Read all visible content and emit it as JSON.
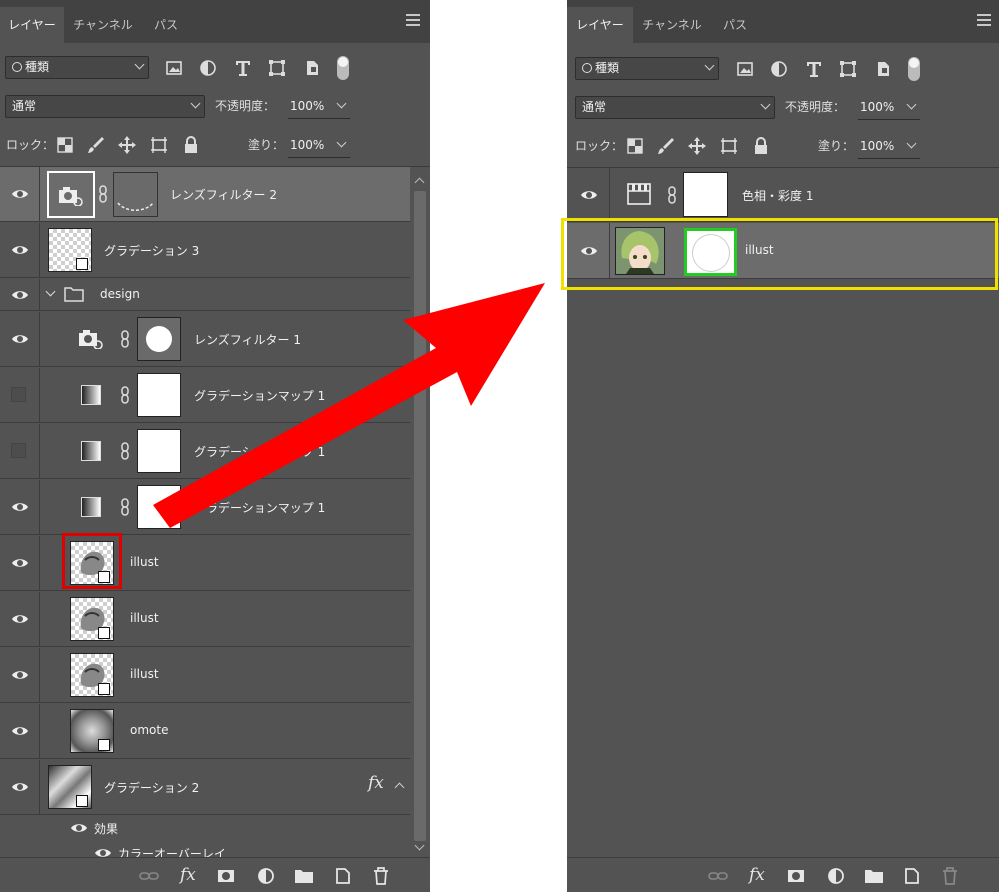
{
  "left_panel": {
    "tabs": [
      "レイヤー",
      "チャンネル",
      "パス"
    ],
    "filter_kind": "種類",
    "blend_mode": "通常",
    "opacity_label": "不透明度：",
    "opacity_value": "100%",
    "lock_label": "ロック：",
    "fill_label": "塗り：",
    "fill_value": "100%",
    "layers": [
      {
        "name": "レンズフィルター 2",
        "visible": true
      },
      {
        "name": "グラデーション 3",
        "visible": true
      },
      {
        "name": "design",
        "visible": true,
        "type": "group"
      },
      {
        "name": "レンズフィルター 1",
        "visible": true
      },
      {
        "name": "グラデーションマップ 1",
        "visible": false
      },
      {
        "name": "グラデーションマップ 1",
        "visible": false
      },
      {
        "name": "グラデーションマップ 1",
        "visible": true
      },
      {
        "name": "illust",
        "visible": true,
        "highlight": "#e00000"
      },
      {
        "name": "illust",
        "visible": true
      },
      {
        "name": "illust",
        "visible": true
      },
      {
        "name": "omote",
        "visible": true
      },
      {
        "name": "グラデーション 2",
        "visible": true,
        "fx": "fx"
      }
    ],
    "effects_label": "効果",
    "effect_item": "カラーオーバーレイ"
  },
  "right_panel": {
    "tabs": [
      "レイヤー",
      "チャンネル",
      "パス"
    ],
    "filter_kind": "種類",
    "blend_mode": "通常",
    "opacity_label": "不透明度：",
    "opacity_value": "100%",
    "lock_label": "ロック：",
    "fill_label": "塗り：",
    "fill_value": "100%",
    "layers": [
      {
        "name": "色相・彩度 1",
        "visible": true
      },
      {
        "name": "illust",
        "visible": true,
        "highlight": "#f0e000",
        "mask_highlight": "#22cc22"
      }
    ]
  },
  "colors": {
    "panel_bg": "#535353",
    "arrow": "#ff0000",
    "red_highlight": "#e00000",
    "yellow_highlight": "#f0e000",
    "green_highlight": "#22cc22"
  },
  "icons": [
    "eye-icon",
    "link-icon",
    "fx-icon",
    "mask-icon",
    "adjustment-icon",
    "folder-icon",
    "new-layer-icon",
    "trash-icon",
    "camera-icon",
    "gradient-map-icon",
    "smart-object-icon"
  ]
}
